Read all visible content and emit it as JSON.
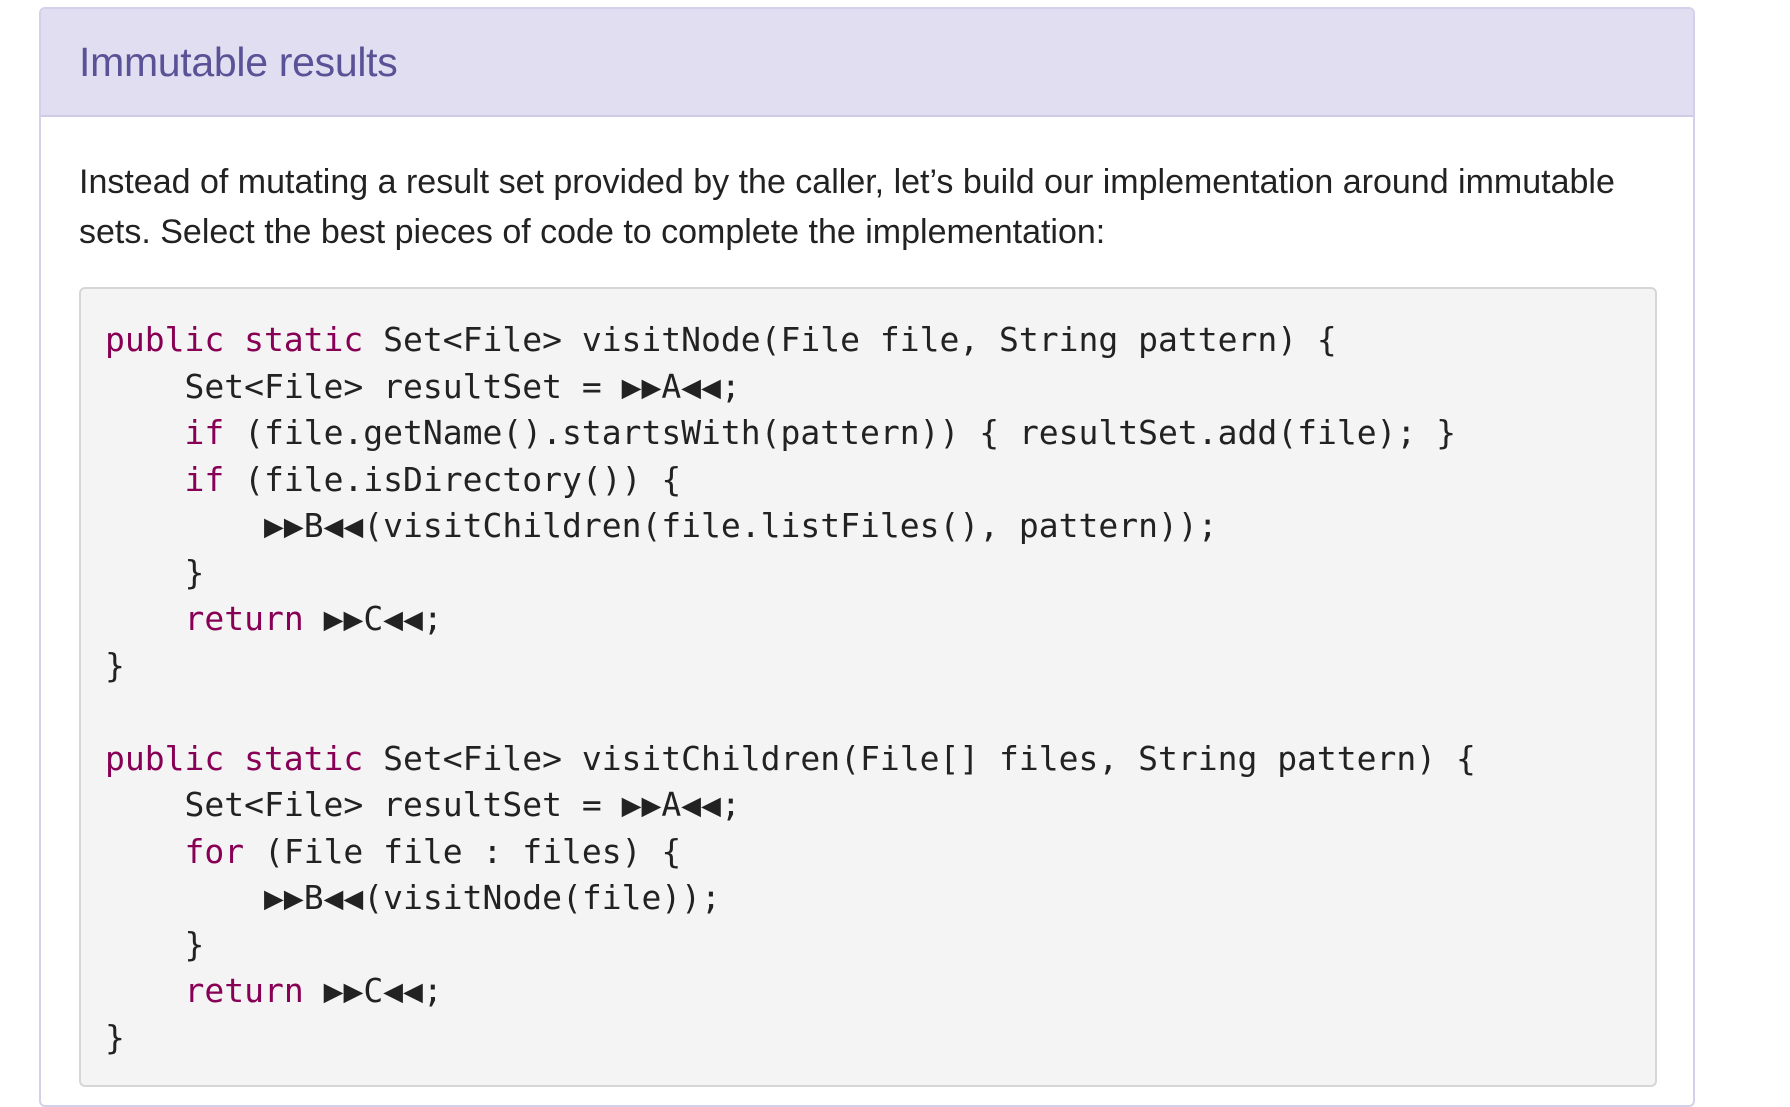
{
  "panel": {
    "title": "Immutable results",
    "intro": "Instead of mutating a result set provided by the caller, let’s build our implementation around immutable sets. Select the best pieces of code to complete the implementation:"
  },
  "code": {
    "line1": {
      "kw": "public static",
      "rest": " Set<File> visitNode(File file, String pattern) {"
    },
    "line2": {
      "indent": "    ",
      "text": "Set<File> resultSet = ",
      "blank": "▶▶A◀◀",
      "after": ";"
    },
    "line3": {
      "indent": "    ",
      "kw": "if",
      "rest": " (file.getName().startsWith(pattern)) { resultSet.add(file); }"
    },
    "line4": {
      "indent": "    ",
      "kw": "if",
      "rest": " (file.isDirectory()) {"
    },
    "line5": {
      "indent": "        ",
      "blank": "▶▶B◀◀",
      "rest": "(visitChildren(file.listFiles(), pattern));"
    },
    "line6": {
      "text": "    }"
    },
    "line7": {
      "indent": "    ",
      "kw": "return",
      "sp": " ",
      "blank": "▶▶C◀◀",
      "after": ";"
    },
    "line8": {
      "text": "}"
    },
    "line10": {
      "kw": "public static",
      "rest": " Set<File> visitChildren(File[] files, String pattern) {"
    },
    "line11": {
      "indent": "    ",
      "text": "Set<File> resultSet = ",
      "blank": "▶▶A◀◀",
      "after": ";"
    },
    "line12": {
      "indent": "    ",
      "kw": "for",
      "rest": " (File file : files) {"
    },
    "line13": {
      "indent": "        ",
      "blank": "▶▶B◀◀",
      "rest": "(visitNode(file));"
    },
    "line14": {
      "text": "    }"
    },
    "line15": {
      "indent": "    ",
      "kw": "return",
      "sp": " ",
      "blank": "▶▶C◀◀",
      "after": ";"
    },
    "line16": {
      "text": "}"
    }
  },
  "colors": {
    "heading_bg": "#e1def2",
    "heading_text": "#5a5296",
    "keyword": "#880055",
    "code_bg": "#f4f4f4"
  }
}
